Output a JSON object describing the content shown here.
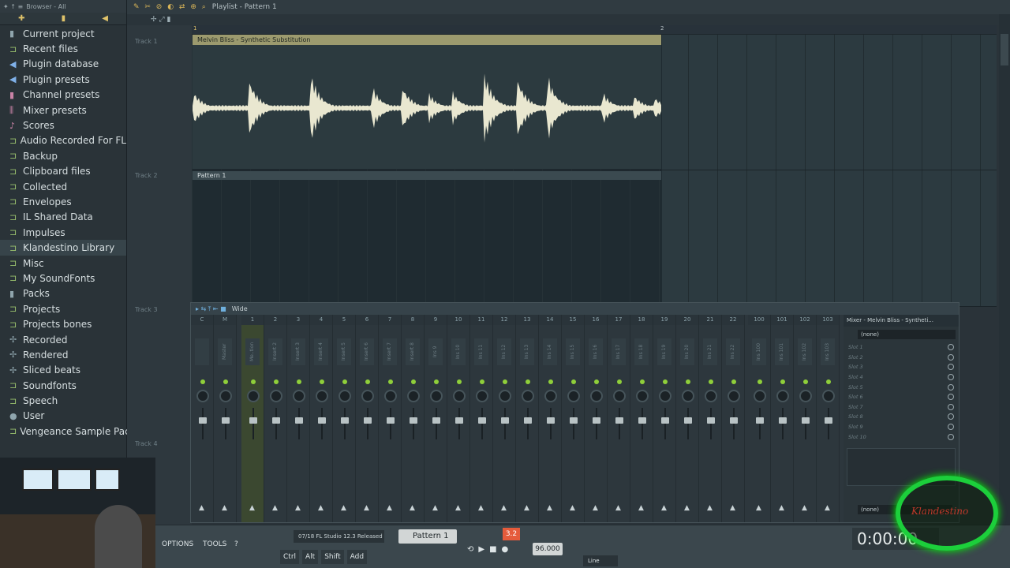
{
  "browser": {
    "header": "Browser - All",
    "items": [
      {
        "label": "Current project",
        "icon": "project-icon",
        "sel": false
      },
      {
        "label": "Recent files",
        "icon": "folder-icon",
        "sel": false
      },
      {
        "label": "Plugin database",
        "icon": "plug-icon",
        "sel": false
      },
      {
        "label": "Plugin presets",
        "icon": "plug-icon",
        "sel": false
      },
      {
        "label": "Channel presets",
        "icon": "channel-icon",
        "sel": false
      },
      {
        "label": "Mixer presets",
        "icon": "mixer-icon",
        "sel": false
      },
      {
        "label": "Scores",
        "icon": "note-icon",
        "sel": false
      },
      {
        "label": "Audio Recorded For FL",
        "icon": "folder-icon",
        "sel": false
      },
      {
        "label": "Backup",
        "icon": "folder-icon",
        "sel": false
      },
      {
        "label": "Clipboard files",
        "icon": "folder-icon",
        "sel": false
      },
      {
        "label": "Collected",
        "icon": "folder-icon",
        "sel": false
      },
      {
        "label": "Envelopes",
        "icon": "folder-icon",
        "sel": false
      },
      {
        "label": "IL Shared Data",
        "icon": "folder-icon",
        "sel": false
      },
      {
        "label": "Impulses",
        "icon": "folder-icon",
        "sel": false
      },
      {
        "label": "Klandestino Library",
        "icon": "folder-icon",
        "sel": true
      },
      {
        "label": "Misc",
        "icon": "folder-icon",
        "sel": false
      },
      {
        "label": "My SoundFonts",
        "icon": "folder-icon",
        "sel": false
      },
      {
        "label": "Packs",
        "icon": "packs-icon",
        "sel": false
      },
      {
        "label": "Projects",
        "icon": "folder-icon",
        "sel": false
      },
      {
        "label": "Projects bones",
        "icon": "folder-icon",
        "sel": false
      },
      {
        "label": "Recorded",
        "icon": "recorded-icon",
        "sel": false
      },
      {
        "label": "Rendered",
        "icon": "rendered-icon",
        "sel": false
      },
      {
        "label": "Sliced beats",
        "icon": "sliced-icon",
        "sel": false
      },
      {
        "label": "Soundfonts",
        "icon": "folder-icon",
        "sel": false
      },
      {
        "label": "Speech",
        "icon": "folder-icon",
        "sel": false
      },
      {
        "label": "User",
        "icon": "user-icon",
        "sel": false
      },
      {
        "label": "Vengeance Sample Packs",
        "icon": "folder-icon",
        "sel": false
      }
    ]
  },
  "playlist": {
    "title": "Playlist - Pattern 1",
    "tracks": [
      "Track 1",
      "Track 2",
      "Track 3",
      "Track 4"
    ],
    "ruler_marks": [
      "1",
      "2"
    ],
    "clip1_label": "Melvin Bliss - Synthetic Substitution",
    "clip2_label": "Pattern 1"
  },
  "mixer": {
    "view_label": "Wide",
    "panel_title": "Mixer - Melvin Bliss - Syntheti...",
    "selected_name": "Me..tion",
    "channels": [
      "C",
      "M",
      "1",
      "2",
      "3",
      "4",
      "5",
      "6",
      "7",
      "8",
      "9",
      "10",
      "11",
      "12",
      "13",
      "14",
      "15",
      "16",
      "17",
      "18",
      "19",
      "20",
      "21",
      "22",
      "100",
      "101",
      "102",
      "103"
    ],
    "strip_names": [
      "",
      "Master",
      "Me..tion",
      "Insert 2",
      "Insert 3",
      "Insert 4",
      "Insert 5",
      "Insert 6",
      "Insert 7",
      "Insert 8",
      "Ins 9",
      "Ins 10",
      "Ins 11",
      "Ins 12",
      "Ins 13",
      "Ins 14",
      "Ins 15",
      "Ins 16",
      "Ins 17",
      "Ins 18",
      "Ins 19",
      "Ins 20",
      "Ins 21",
      "Ins 22",
      "Ins 100",
      "Ins 101",
      "Ins 102",
      "Ins 103"
    ],
    "slot_none": "(none)",
    "slots": [
      "Slot 1",
      "Slot 2",
      "Slot 3",
      "Slot 4",
      "Slot 5",
      "Slot 6",
      "Slot 7",
      "Slot 8",
      "Slot 9",
      "Slot 10"
    ],
    "bottom_none": "(none)"
  },
  "toolbar": {
    "options": "OPTIONS",
    "tools": "TOOLS",
    "help": "?",
    "hint": "07/18 FL Studio 12.3 Released",
    "pattern": "Pattern 1",
    "pattern_num": "3.2",
    "tempo": "96.000",
    "keys": [
      "Ctrl",
      "Alt",
      "Shift",
      "Add"
    ],
    "line_mode": "Line",
    "time": "0:00:00"
  },
  "overlay": {
    "logo_text": "Klandestino"
  }
}
